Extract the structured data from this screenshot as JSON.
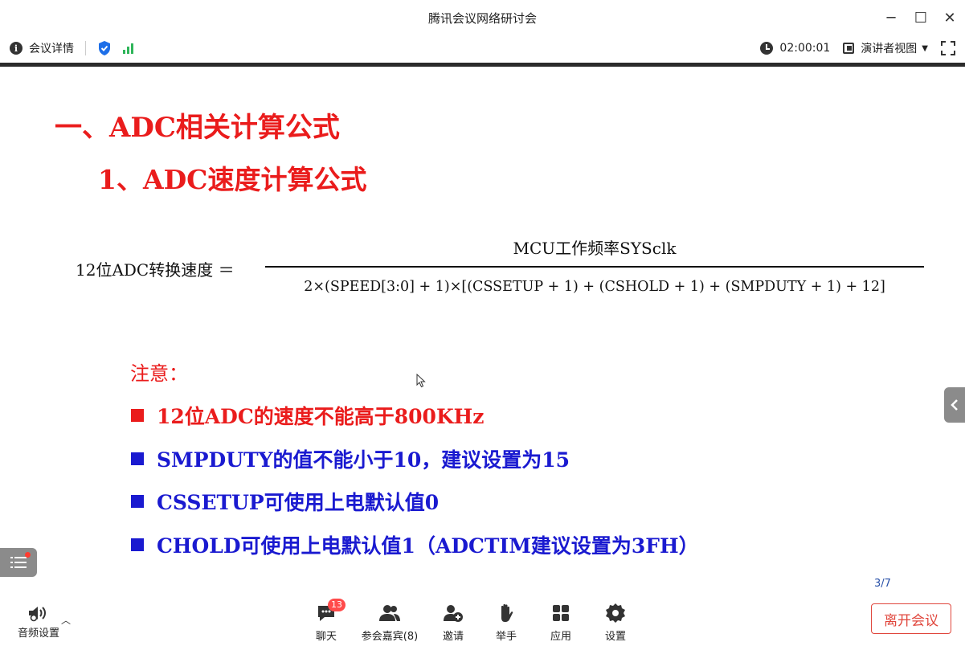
{
  "window": {
    "title": "腾讯会议网络研讨会",
    "minimize": "─",
    "maximize": "☐",
    "close": "✕"
  },
  "infobar": {
    "meeting_details": "会议详情",
    "timer": "02:00:01",
    "view_mode": "演讲者视图"
  },
  "slide": {
    "heading1": "一、ADC相关计算公式",
    "heading2": "1、ADC速度计算公式",
    "formula_lhs": "12位ADC转换速度 ＝",
    "formula_numerator": "MCU工作频率SYSclk",
    "formula_denominator": "2×(SPEED[3:0] + 1)×[(CSSETUP + 1) + (CSHOLD + 1) + (SMPDUTY + 1) + 12]",
    "note_title": "注意：",
    "bullets": [
      "12位ADC的速度不能高于800KHz",
      "SMPDUTY的值不能小于10，建议设置为15",
      "CSSETUP可使用上电默认值0",
      "CHOLD可使用上电默认值1（ADCTIM建议设置为3FH）"
    ],
    "page_indicator": "3/7"
  },
  "toolbar": {
    "audio_settings": "音频设置",
    "chat": "聊天",
    "chat_badge": "13",
    "participants": "参会嘉宾(8)",
    "invite": "邀请",
    "raise_hand": "举手",
    "apps": "应用",
    "settings": "设置",
    "leave": "离开会议"
  },
  "colors": {
    "heading_red": "#ea1c1c",
    "bullet_blue": "#1a1ad0",
    "signal_green": "#2fb55a",
    "shield_blue": "#1e6fe8",
    "leave_red": "#e0463c"
  }
}
